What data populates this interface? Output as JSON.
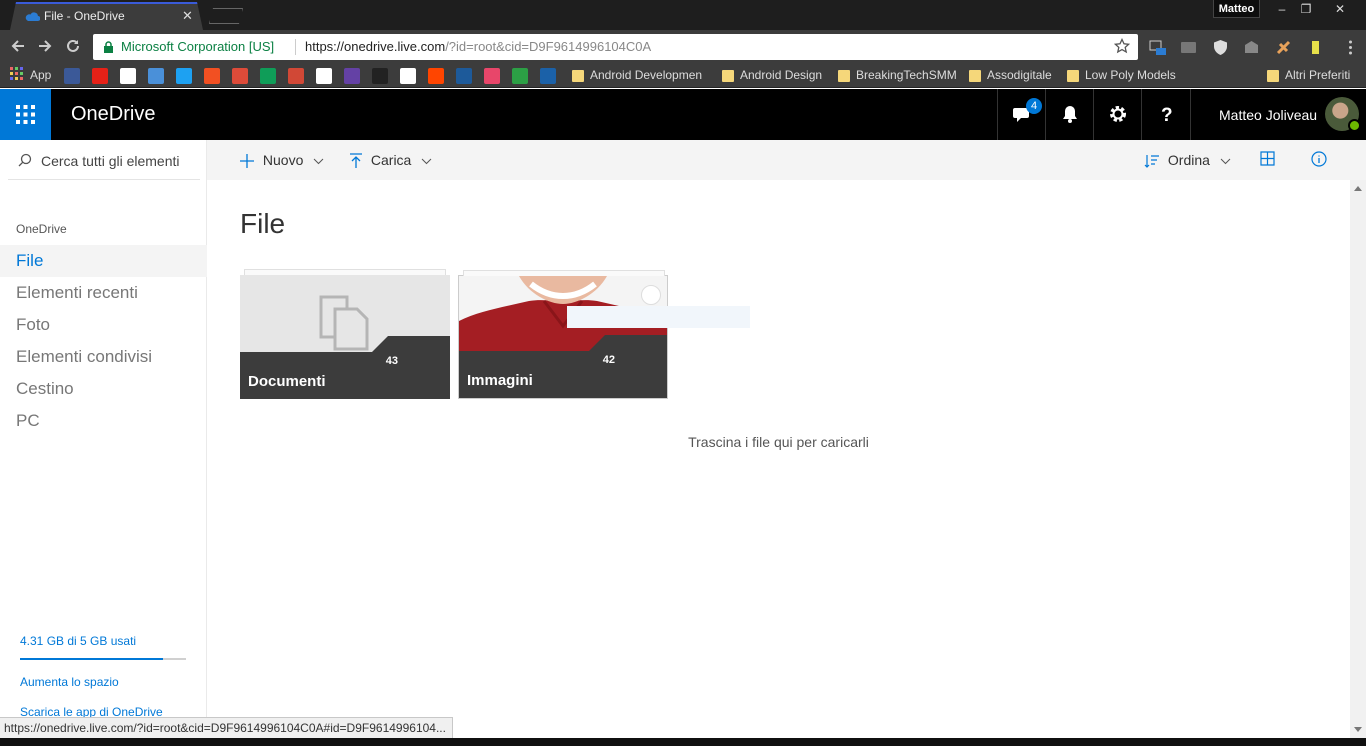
{
  "browser": {
    "tab_title": "File - OneDrive",
    "tab_close": "✕",
    "profile_name": "Matteo",
    "window_buttons": [
      "–",
      "❐",
      "✕"
    ],
    "security_label": "Microsoft Corporation [US]",
    "url_host": "https://onedrive.live.com",
    "url_path": "/?id=root&cid=D9F9614996104C0A",
    "bookmarks": {
      "apps_label": "App",
      "icon_names": [
        "facebook-icon",
        "youtube-icon",
        "amazon-icon",
        "mail-check-icon",
        "twitter-icon",
        "microsoft-icon",
        "google-plus-icon",
        "drive-icon",
        "gmail-icon",
        "wikipedia-icon",
        "twitch-icon",
        "l-icon",
        "news-icon",
        "reddit-icon",
        "unreal-icon",
        "app-icon",
        "px-icon",
        "shield-bookmark-icon"
      ],
      "icon_colors": [
        "#3b5998",
        "#e62117",
        "#ffffff",
        "#4a90d9",
        "#1da1f2",
        "#f25022",
        "#dd4b39",
        "#0f9d58",
        "#d14836",
        "#ffffff",
        "#6441a5",
        "#222222",
        "#ffffff",
        "#ff4500",
        "#1d5a9a",
        "#e8466a",
        "#2c9f45",
        "#1b61a8"
      ],
      "folders": [
        "Android Developmen",
        "Android Design",
        "BreakingTechSMM",
        "Assodigitale",
        "Low Poly Models"
      ],
      "other": "Altri Preferiti"
    }
  },
  "suitebar": {
    "brand": "OneDrive",
    "chat_badge": "4",
    "user_name": "Matteo Joliveau"
  },
  "leftnav": {
    "search_placeholder": "Cerca tutti gli elementi",
    "heading": "OneDrive",
    "items": [
      "File",
      "Elementi recenti",
      "Foto",
      "Elementi condivisi",
      "Cestino",
      "PC"
    ],
    "active_index": 0,
    "quota_text": "4.31 GB di 5 GB usati",
    "quota_used_fraction": 0.862,
    "links": [
      "Aumenta lo spazio",
      "Scarica le app di OneDrive"
    ]
  },
  "commandbar": {
    "new_label": "Nuovo",
    "upload_label": "Carica",
    "sort_label": "Ordina"
  },
  "main": {
    "title": "File",
    "tiles": [
      {
        "name": "Documenti",
        "count": "43"
      },
      {
        "name": "Immagini",
        "count": "42"
      }
    ],
    "drop_hint": "Trascina i file qui per caricarli"
  },
  "status_url": "https://onedrive.live.com/?id=root&cid=D9F9614996104C0A#id=D9F9614996104...",
  "colors": {
    "accent": "#0078d7",
    "suitebar": "#000000",
    "browser_chrome": "#3c3c3c"
  }
}
